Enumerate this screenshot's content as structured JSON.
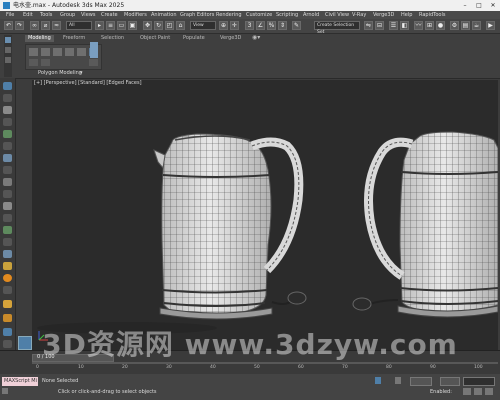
{
  "window": {
    "title": "电水壶.max - Autodesk 3ds Max 2025"
  },
  "menu": [
    "File",
    "Edit",
    "Tools",
    "Group",
    "Views",
    "Create",
    "Modifiers",
    "Animation",
    "Graph Editors",
    "Rendering",
    "Customize",
    "Scripting",
    "Arnold",
    "Civil View",
    "V-Ray",
    "Verge3D",
    "Help",
    "RapidTools"
  ],
  "toolbar": {
    "filter": "All",
    "view": "View",
    "selection_set": "Create Selection Set"
  },
  "ribbon": {
    "tabs": [
      "Modeling",
      "Freeform",
      "Selection",
      "Object Paint",
      "Populate",
      "Verge3D"
    ],
    "active_tab": "Modeling",
    "panel_label": "Polygon Modeling"
  },
  "viewport": {
    "label": "[+] [Perspective] [Standard] [Edged Faces]"
  },
  "timeline": {
    "frame": "0 / 100",
    "ticks": [
      "0",
      "10",
      "20",
      "30",
      "40",
      "50",
      "60",
      "70",
      "80",
      "90",
      "100"
    ]
  },
  "status": {
    "selection": "None Selected",
    "hint": "Click or click-and-drag to select objects",
    "enabled": "Enabled:",
    "script_label": "MAXScript Mi"
  },
  "watermark": {
    "text": "3D资源网 www.3dzyw.com"
  },
  "colors": {
    "viewport_bg": "#2b2b2b",
    "active_tab": "#5a5a5a",
    "logo": "#2a7fbf"
  }
}
